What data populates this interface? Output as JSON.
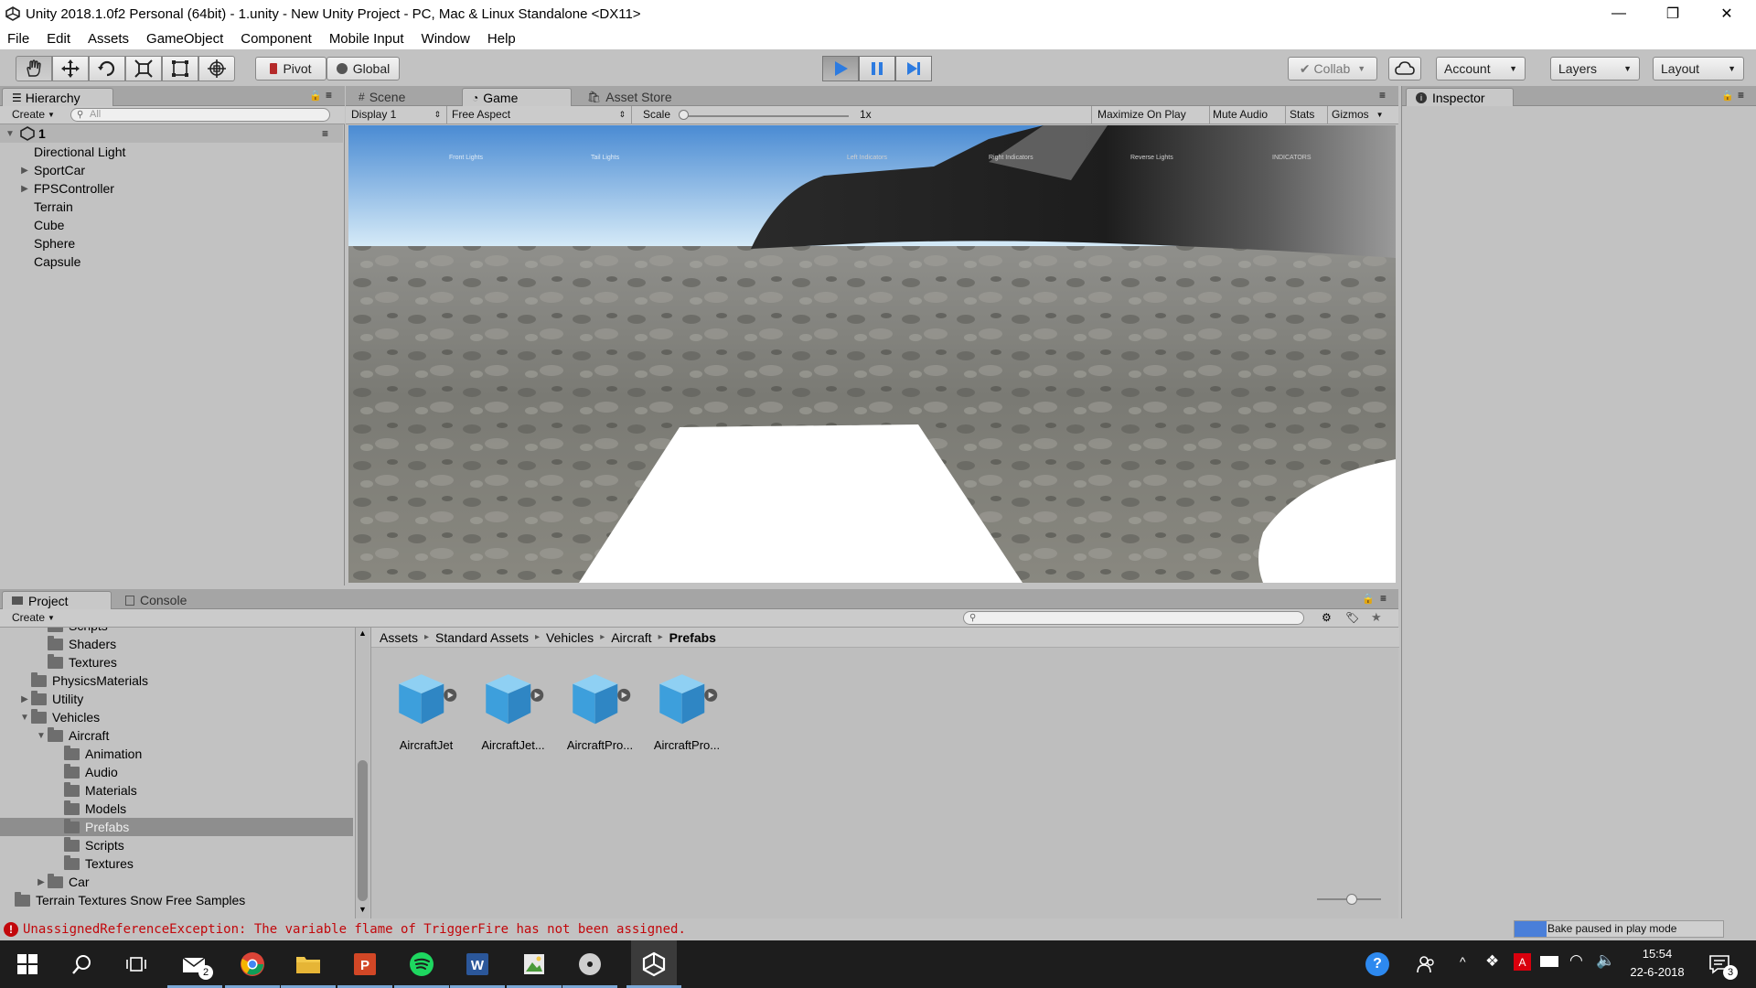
{
  "window": {
    "title": "Unity 2018.1.0f2 Personal (64bit) - 1.unity - New Unity Project - PC, Mac & Linux Standalone <DX11>",
    "minimize": "—",
    "restore": "❐",
    "close": "✕"
  },
  "menu": [
    "File",
    "Edit",
    "Assets",
    "GameObject",
    "Component",
    "Mobile Input",
    "Window",
    "Help"
  ],
  "toolbar": {
    "pivot": "Pivot",
    "global": "Global",
    "collab": "Collab",
    "account": "Account",
    "layers": "Layers",
    "layout": "Layout"
  },
  "hierarchy": {
    "tab": "Hierarchy",
    "create": "Create",
    "search_placeholder": "All",
    "scene": "1",
    "items": [
      {
        "label": "Directional Light",
        "expandable": false
      },
      {
        "label": "SportCar",
        "expandable": true
      },
      {
        "label": "FPSController",
        "expandable": true
      },
      {
        "label": "Terrain",
        "expandable": false
      },
      {
        "label": "Cube",
        "expandable": false
      },
      {
        "label": "Sphere",
        "expandable": false
      },
      {
        "label": "Capsule",
        "expandable": false
      }
    ]
  },
  "viewport": {
    "tabs": [
      "Scene",
      "Game",
      "Asset Store"
    ],
    "display": "Display 1",
    "aspect": "Free Aspect",
    "scale_label": "Scale",
    "scale_value": "1x",
    "buttons": [
      "Maximize On Play",
      "Mute Audio",
      "Stats",
      "Gizmos"
    ],
    "overlay_labels": [
      "Front Lights",
      "Tail Lights",
      "Left Indicators",
      "Right Indicators",
      "Reverse Lights",
      "INDICATORS"
    ]
  },
  "inspector": {
    "tab": "Inspector"
  },
  "project": {
    "tabs": [
      "Project",
      "Console"
    ],
    "create": "Create",
    "tree": [
      {
        "label": "Scripts",
        "depth": 3
      },
      {
        "label": "Shaders",
        "depth": 3
      },
      {
        "label": "Textures",
        "depth": 3
      },
      {
        "label": "PhysicsMaterials",
        "depth": 2
      },
      {
        "label": "Utility",
        "depth": 2,
        "arrow": "▶"
      },
      {
        "label": "Vehicles",
        "depth": 2,
        "arrow": "▼"
      },
      {
        "label": "Aircraft",
        "depth": 3,
        "arrow": "▼"
      },
      {
        "label": "Animation",
        "depth": 4
      },
      {
        "label": "Audio",
        "depth": 4
      },
      {
        "label": "Materials",
        "depth": 4
      },
      {
        "label": "Models",
        "depth": 4
      },
      {
        "label": "Prefabs",
        "depth": 4,
        "selected": true
      },
      {
        "label": "Scripts",
        "depth": 4
      },
      {
        "label": "Textures",
        "depth": 4
      },
      {
        "label": "Car",
        "depth": 3,
        "arrow": "▶"
      },
      {
        "label": "Terrain Textures Snow Free Samples",
        "depth": 1
      }
    ],
    "breadcrumb": [
      "Assets",
      "Standard Assets",
      "Vehicles",
      "Aircraft",
      "Prefabs"
    ],
    "breadcrumb_sep": "▸",
    "assets": [
      "AircraftJet",
      "AircraftJet...",
      "AircraftPro...",
      "AircraftPro..."
    ]
  },
  "status": {
    "error": "UnassignedReferenceException: The variable flame of TriggerFire has not been assigned.",
    "bake": "Bake paused in play mode"
  },
  "taskbar": {
    "mail_badge": "2",
    "time": "15:54",
    "date": "22-6-2018",
    "notif_badge": "3"
  },
  "colors": {
    "play_blue": "#2d7be0",
    "error_red": "#c2070b",
    "selection": "#8e8e8e",
    "bake_bar": "#4a7fd9"
  }
}
